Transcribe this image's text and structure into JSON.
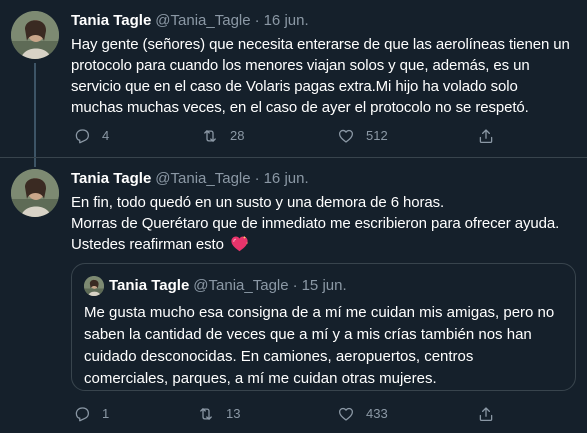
{
  "tweets": [
    {
      "author": {
        "name": "Tania Tagle",
        "handle": "@Tania_Tagle",
        "separator": "·",
        "date": "16 jun."
      },
      "text_lines": [
        "Hay gente (señores) que necesita enterarse de que las aerolíneas tienen un",
        "protocolo para cuando los menores viajan solos y que, además, es un",
        "servicio que en el caso de Volaris pagas extra.Mi hijo ha volado solo",
        "muchas muchas veces, en el caso de ayer el protocolo no se respetó."
      ],
      "actions": {
        "reply_icon": "reply-icon",
        "reply_count": "4",
        "retweet_icon": "retweet-icon",
        "retweet_count": "28",
        "like_icon": "heart-icon",
        "like_count": "512",
        "share_icon": "share-icon"
      }
    },
    {
      "author": {
        "name": "Tania Tagle",
        "handle": "@Tania_Tagle",
        "separator": "·",
        "date": "16 jun."
      },
      "text_lines": [
        "En fin, todo quedó en un susto y una demora de 6 horas.",
        "Morras de Querétaro que de inmediato me escribieron para ofrecer ayuda.",
        "Ustedes reafirman esto"
      ],
      "emoji": "sparkling-heart-emoji",
      "quoted": {
        "author": {
          "name": "Tania Tagle",
          "handle": "@Tania_Tagle",
          "separator": "·",
          "date": "15 jun."
        },
        "text_lines": [
          "Me gusta mucho esa consigna de a mí me cuidan mis amigas, pero no",
          "saben la cantidad de veces que a mí y a mis crías también nos han",
          "cuidado desconocidas. En camiones, aeropuertos, centros",
          "comerciales, parques, a mí me cuidan otras mujeres."
        ]
      },
      "actions": {
        "reply_icon": "reply-icon",
        "reply_count": "1",
        "retweet_icon": "retweet-icon",
        "retweet_count": "13",
        "like_icon": "heart-icon",
        "like_count": "433",
        "share_icon": "share-icon"
      }
    }
  ],
  "colors": {
    "background": "#15202b",
    "text": "#ffffff",
    "secondary_text": "#8b98a5",
    "border": "#38444d",
    "emoji_heart": "#e8346b"
  }
}
